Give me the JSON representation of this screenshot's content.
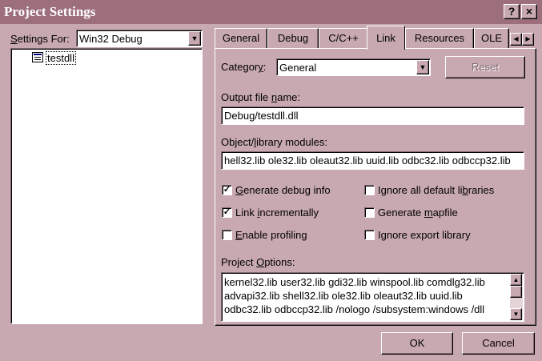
{
  "window": {
    "title": "Project Settings",
    "help_label": "?",
    "close_label": "×"
  },
  "settings_for": {
    "label": "Settings For:",
    "value": "Win32 Debug"
  },
  "tree": {
    "items": [
      {
        "label": "testdll"
      }
    ]
  },
  "tabs": [
    {
      "label": "General"
    },
    {
      "label": "Debug"
    },
    {
      "label": "C/C++"
    },
    {
      "label": "Link",
      "active": true
    },
    {
      "label": "Resources"
    },
    {
      "label": "OLE"
    }
  ],
  "link_tab": {
    "category_label": "Category:",
    "category_value": "General",
    "reset_label": "Reset",
    "output_file_label": "Output file name:",
    "output_file_value": "Debug/testdll.dll",
    "modules_label": "Object/library modules:",
    "modules_value": "hell32.lib ole32.lib oleaut32.lib uuid.lib odbc32.lib odbccp32.lib",
    "checkboxes": {
      "generate_debug_info": {
        "label": "Generate debug info",
        "checked": true
      },
      "link_incrementally": {
        "label": "Link incrementally",
        "checked": true
      },
      "enable_profiling": {
        "label": "Enable profiling",
        "checked": false
      },
      "ignore_default_libs": {
        "label": "Ignore all default libraries",
        "checked": false
      },
      "generate_mapfile": {
        "label": "Generate mapfile",
        "checked": false
      },
      "ignore_export_lib": {
        "label": "Ignore export library",
        "checked": false
      }
    },
    "project_options_label": "Project Options:",
    "project_options_lines": [
      "kernel32.lib user32.lib gdi32.lib winspool.lib comdlg32.lib",
      "advapi32.lib shell32.lib ole32.lib oleaut32.lib uuid.lib",
      "odbc32.lib odbccp32.lib /nologo /subsystem:windows /dll"
    ]
  },
  "buttons": {
    "ok": "OK",
    "cancel": "Cancel"
  },
  "icons": {
    "tree_item": "project-icon",
    "tab_left": "arrow-left-icon",
    "tab_right": "arrow-right-icon"
  },
  "colors": {
    "face": "#c8a9b1",
    "titlebar": "#9d6e7c",
    "shadow": "#7e6a70"
  }
}
